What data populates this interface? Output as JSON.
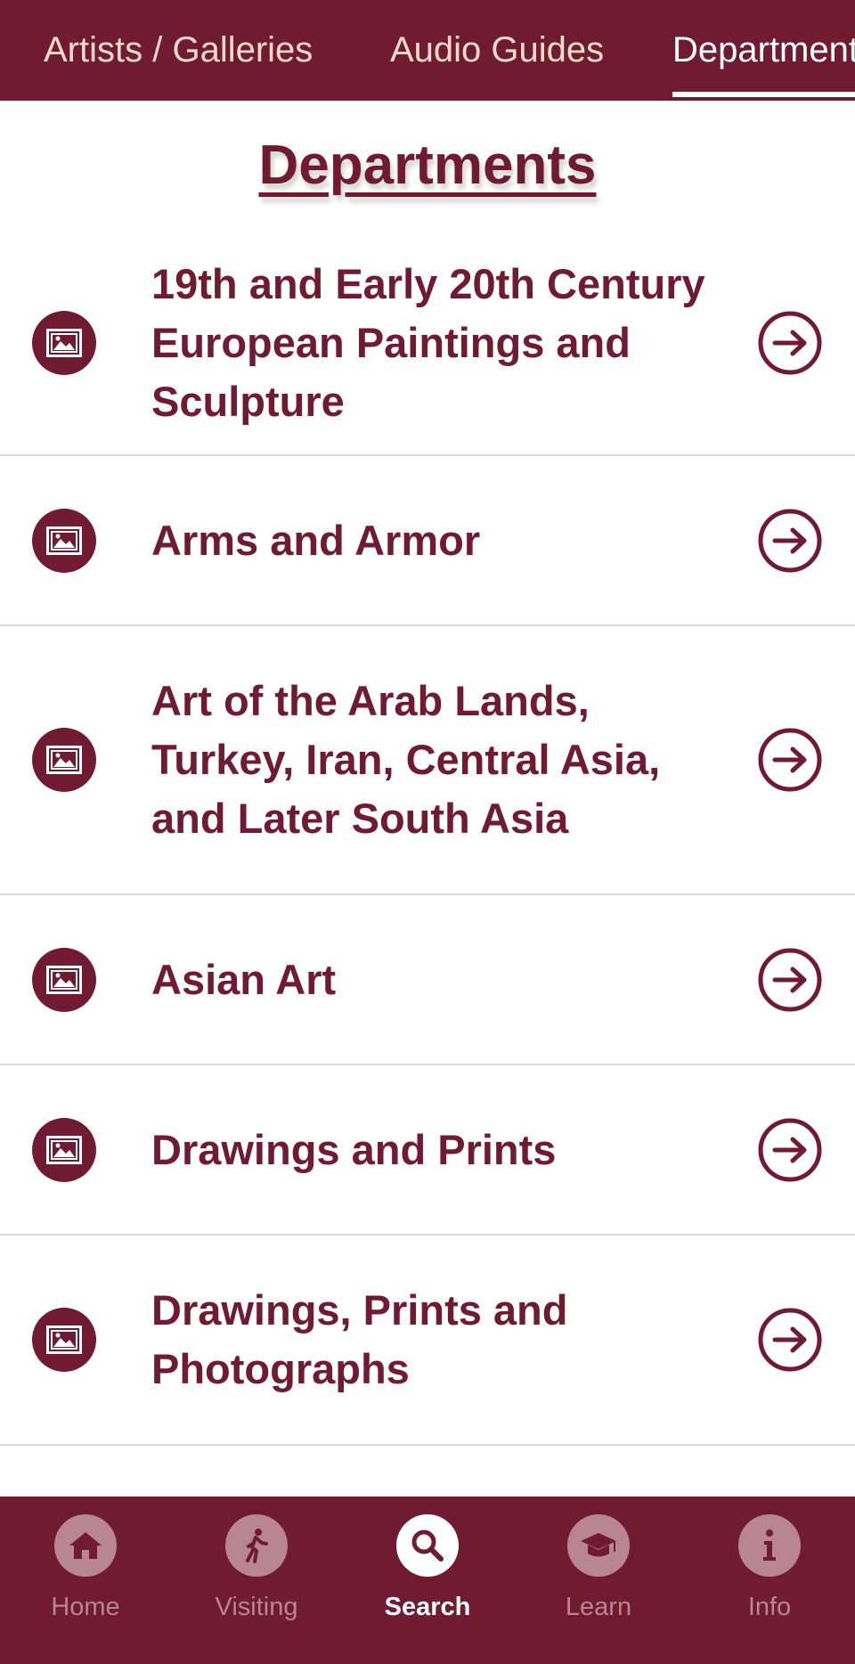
{
  "top_tabs": [
    {
      "label": "Artists / Galleries"
    },
    {
      "label": "Audio Guides"
    },
    {
      "label": "Departments"
    }
  ],
  "active_tab": "Departments",
  "page_title": "Departments",
  "departments": [
    {
      "label": "19th and Early 20th Century European Paintings and Sculpture",
      "icon": "image-icon",
      "action_icon": "arrow-right-circle-icon"
    },
    {
      "label": "Arms and Armor",
      "icon": "image-icon",
      "action_icon": "arrow-right-circle-icon"
    },
    {
      "label": "Art of the Arab Lands, Turkey, Iran, Central Asia, and Later South Asia",
      "icon": "image-icon",
      "action_icon": "arrow-right-circle-icon"
    },
    {
      "label": "Asian Art",
      "icon": "image-icon",
      "action_icon": "arrow-right-circle-icon"
    },
    {
      "label": "Drawings and Prints",
      "icon": "image-icon",
      "action_icon": "arrow-right-circle-icon"
    },
    {
      "label": "Drawings, Prints and Photographs",
      "icon": "image-icon",
      "action_icon": "arrow-right-circle-icon"
    }
  ],
  "bottom_nav": [
    {
      "label": "Home",
      "icon": "home-icon"
    },
    {
      "label": "Visiting",
      "icon": "walking-person-icon"
    },
    {
      "label": "Search",
      "icon": "search-icon"
    },
    {
      "label": "Learn",
      "icon": "graduation-cap-icon"
    },
    {
      "label": "Info",
      "icon": "info-icon"
    }
  ],
  "active_nav": "Search",
  "colors": {
    "brand": "#711b32",
    "tab_text": "#f6dcc7",
    "nav_inactive": "#b88595",
    "divider": "#d9d9d9"
  }
}
